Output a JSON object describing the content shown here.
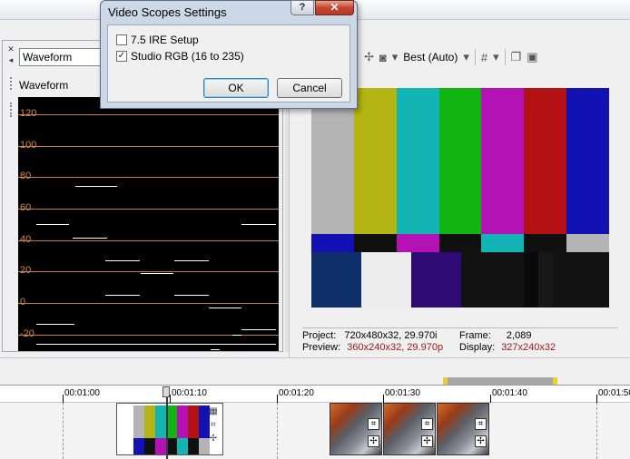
{
  "dialog": {
    "title": "Video Scopes Settings",
    "help_label": "?",
    "close_label": "✕",
    "options": [
      {
        "label": "7.5 IRE Setup",
        "checked": false,
        "mark": ""
      },
      {
        "label": "Studio RGB (16 to 235)",
        "checked": true,
        "mark": "✓"
      }
    ],
    "ok_label": "OK",
    "cancel_label": "Cancel"
  },
  "scopes_panel": {
    "selector_value": "Waveform",
    "scope_label": "Waveform",
    "y_ticks": [
      "120",
      "100",
      "80",
      "60",
      "40",
      "20",
      "0",
      "-20"
    ]
  },
  "preview_panel": {
    "quality_value": "Best (Auto)",
    "project_label": "Project:",
    "project_value": "720x480x32, 29.970i",
    "preview_label": "Preview:",
    "preview_value": "360x240x32, 29.970p",
    "frame_label": "Frame:",
    "frame_value": "2,089",
    "display_label": "Display:",
    "display_value": "327x240x32"
  },
  "timeline": {
    "ruler_labels": [
      "00:01:00",
      "00:01:10",
      "00:01:20",
      "00:01:30",
      "00:01:40",
      "00:01:50"
    ]
  },
  "colors": {
    "bars_top": [
      "#b4b4b4",
      "#b4b412",
      "#12b4b4",
      "#12b412",
      "#b412b4",
      "#b41212",
      "#1212b4"
    ],
    "bars_mid": [
      "#1212b4",
      "#101010",
      "#b412b4",
      "#101010",
      "#12b4b4",
      "#101010",
      "#b4b4b4"
    ],
    "waveform_grid": "#c77a3c"
  },
  "icons": [
    "close-icon",
    "pin-icon",
    "help-icon",
    "grid-icon",
    "copy-icon",
    "save-icon",
    "film-icon",
    "crop-icon",
    "pan-icon",
    "split-icon"
  ]
}
